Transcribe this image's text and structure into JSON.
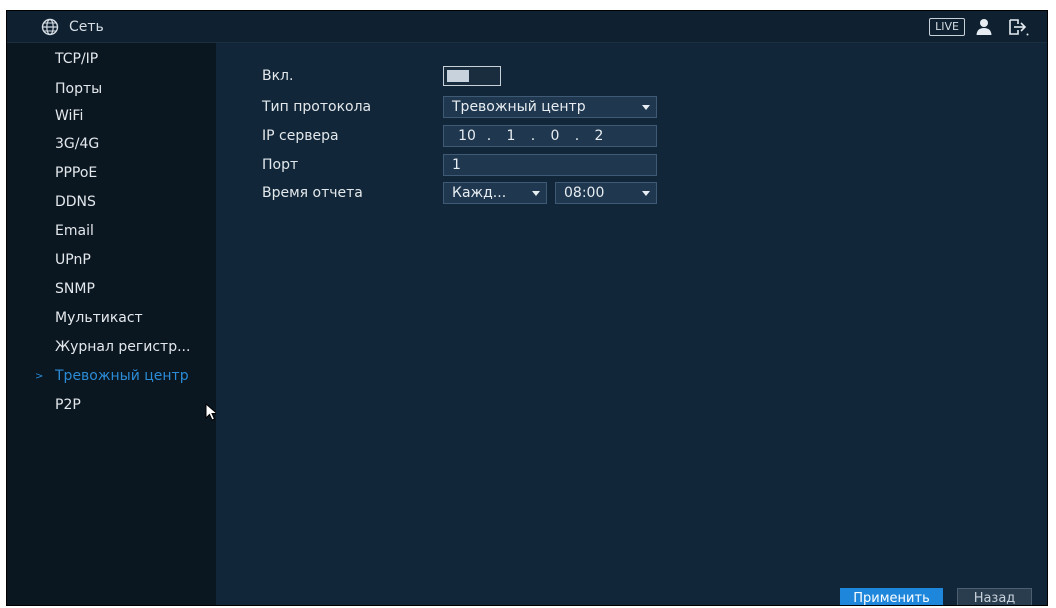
{
  "header": {
    "title": "Сеть",
    "live_badge": "LIVE"
  },
  "sidebar": {
    "items": [
      {
        "label": "TCP/IP"
      },
      {
        "label": "Порты"
      },
      {
        "label": "WiFi"
      },
      {
        "label": "3G/4G"
      },
      {
        "label": "PPPoE"
      },
      {
        "label": "DDNS"
      },
      {
        "label": "Email"
      },
      {
        "label": "UPnP"
      },
      {
        "label": "SNMP"
      },
      {
        "label": "Мультикаст"
      },
      {
        "label": "Журнал регистр..."
      },
      {
        "label": "Тревожный центр",
        "active": true
      },
      {
        "label": "P2P"
      }
    ],
    "active_marker": ">"
  },
  "form": {
    "enable_label": "Вкл.",
    "enable_on": false,
    "protocol_label": "Тип протокола",
    "protocol_value": "Тревожный центр",
    "server_ip_label": "IP сервера",
    "server_ip": [
      "10",
      "1",
      "0",
      "2"
    ],
    "ip_separator": ".",
    "port_label": "Порт",
    "port_value": "1",
    "report_time_label": "Время отчета",
    "report_period_value": "Кажд...",
    "report_time_value": "08:00"
  },
  "buttons": {
    "apply": "Применить",
    "back": "Назад"
  },
  "colors": {
    "accent": "#1e87dc",
    "active_text": "#2b8bd6",
    "background": "#112638",
    "sidebar": "#0a1620"
  },
  "icons": {
    "title": "globe-icon",
    "user": "user-icon",
    "logout": "logout-icon",
    "pointer": "mouse-cursor-icon"
  }
}
